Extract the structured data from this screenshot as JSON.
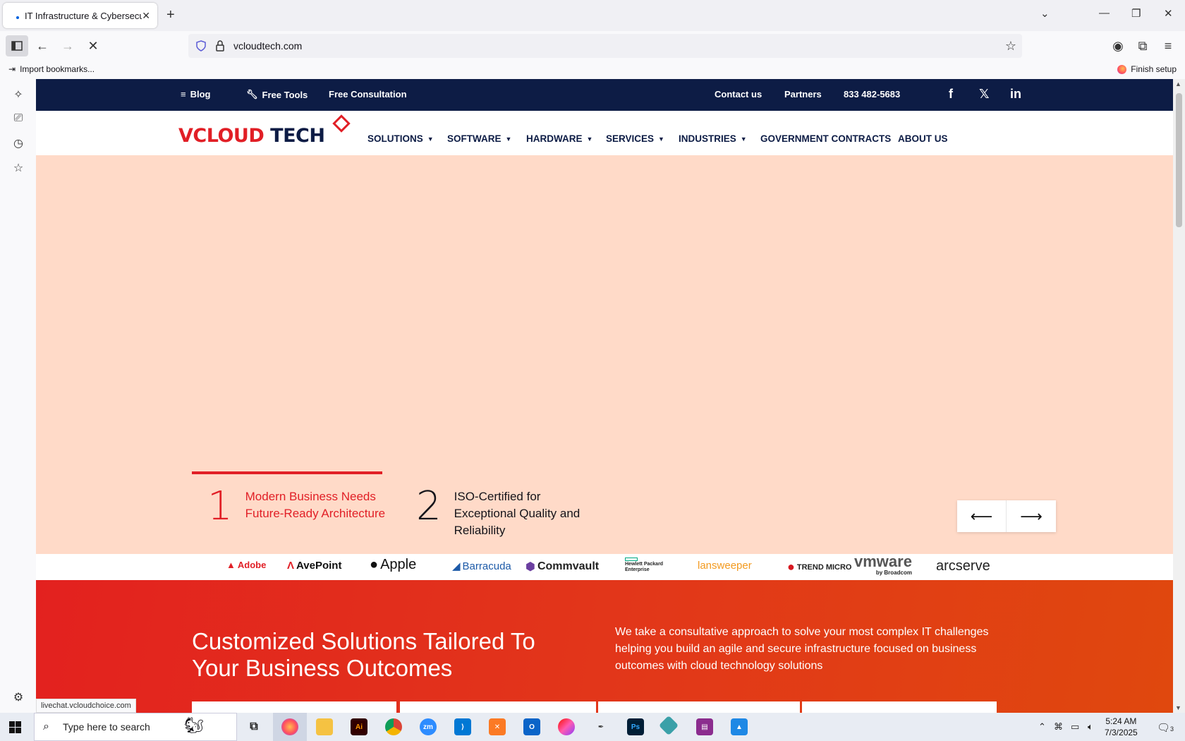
{
  "browser": {
    "tab_title": "IT Infrastructure & Cybersecurit",
    "url": "vcloudtech.com",
    "import_bookmarks": "Import bookmarks...",
    "finish_setup": "Finish setup",
    "status_url": "livechat.vcloudchoice.com"
  },
  "site": {
    "topbar": {
      "blog": "Blog",
      "free_tools": "Free Tools",
      "free_consultation": "Free Consultation",
      "contact": "Contact us",
      "partners": "Partners",
      "phone": "833 482-5683"
    },
    "logo": {
      "v": "V",
      "cloud": "CLOUD",
      "tech": "TECH"
    },
    "menu": [
      "SOLUTIONS",
      "SOFTWARE",
      "HARDWARE",
      "SERVICES",
      "INDUSTRIES",
      "GOVERNMENT CONTRACTS",
      "ABOUT US"
    ],
    "slides": [
      {
        "num": "1",
        "text": "Modern Business Needs Future-Ready Architecture"
      },
      {
        "num": "2",
        "text": "ISO-Certified for Exceptional Quality and Reliability"
      }
    ],
    "brands": [
      "Adobe",
      "AvePoint",
      "Apple",
      "Barracuda",
      "Commvault",
      "Hewlett Packard Enterprise",
      "lansweeper",
      "TREND MICRO",
      "vmware",
      "by Broadcom",
      "arcserve"
    ],
    "cta": {
      "title": "Customized Solutions Tailored To Your Business Outcomes",
      "text": "We take a consultative approach to solve your most complex IT challenges helping you build an agile and secure infrastructure focused on business outcomes with cloud technology solutions"
    }
  },
  "taskbar": {
    "search_placeholder": "Type here to search",
    "time": "5:24 AM",
    "date": "7/3/2025",
    "notifications": "3"
  },
  "colors": {
    "brand_red": "#e11f26",
    "navy": "#0d1c45",
    "hero_bg": "#ffdac8"
  }
}
